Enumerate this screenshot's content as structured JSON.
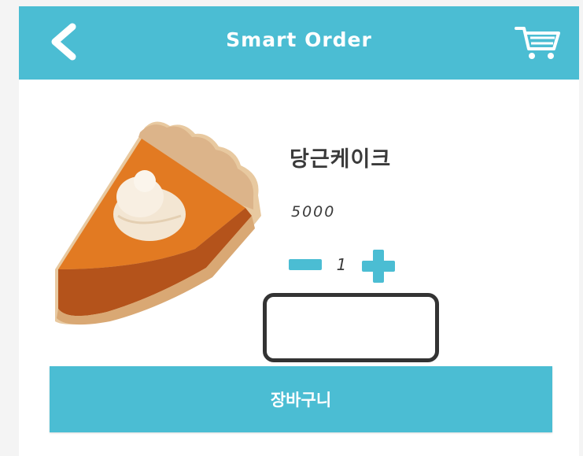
{
  "header": {
    "back_icon": "chevron-left-icon",
    "title": "Smart Order",
    "cart_icon": "shopping-cart-icon",
    "background_color": "#4bbdd3"
  },
  "product": {
    "image": "pie-slice-icon",
    "name": "당근케이크",
    "price": "5000",
    "quantity": "1"
  },
  "quantity_controls": {
    "minus_icon": "minus-icon",
    "plus_icon": "plus-icon"
  },
  "actions": {
    "add_to_cart_label": "장바구니"
  }
}
